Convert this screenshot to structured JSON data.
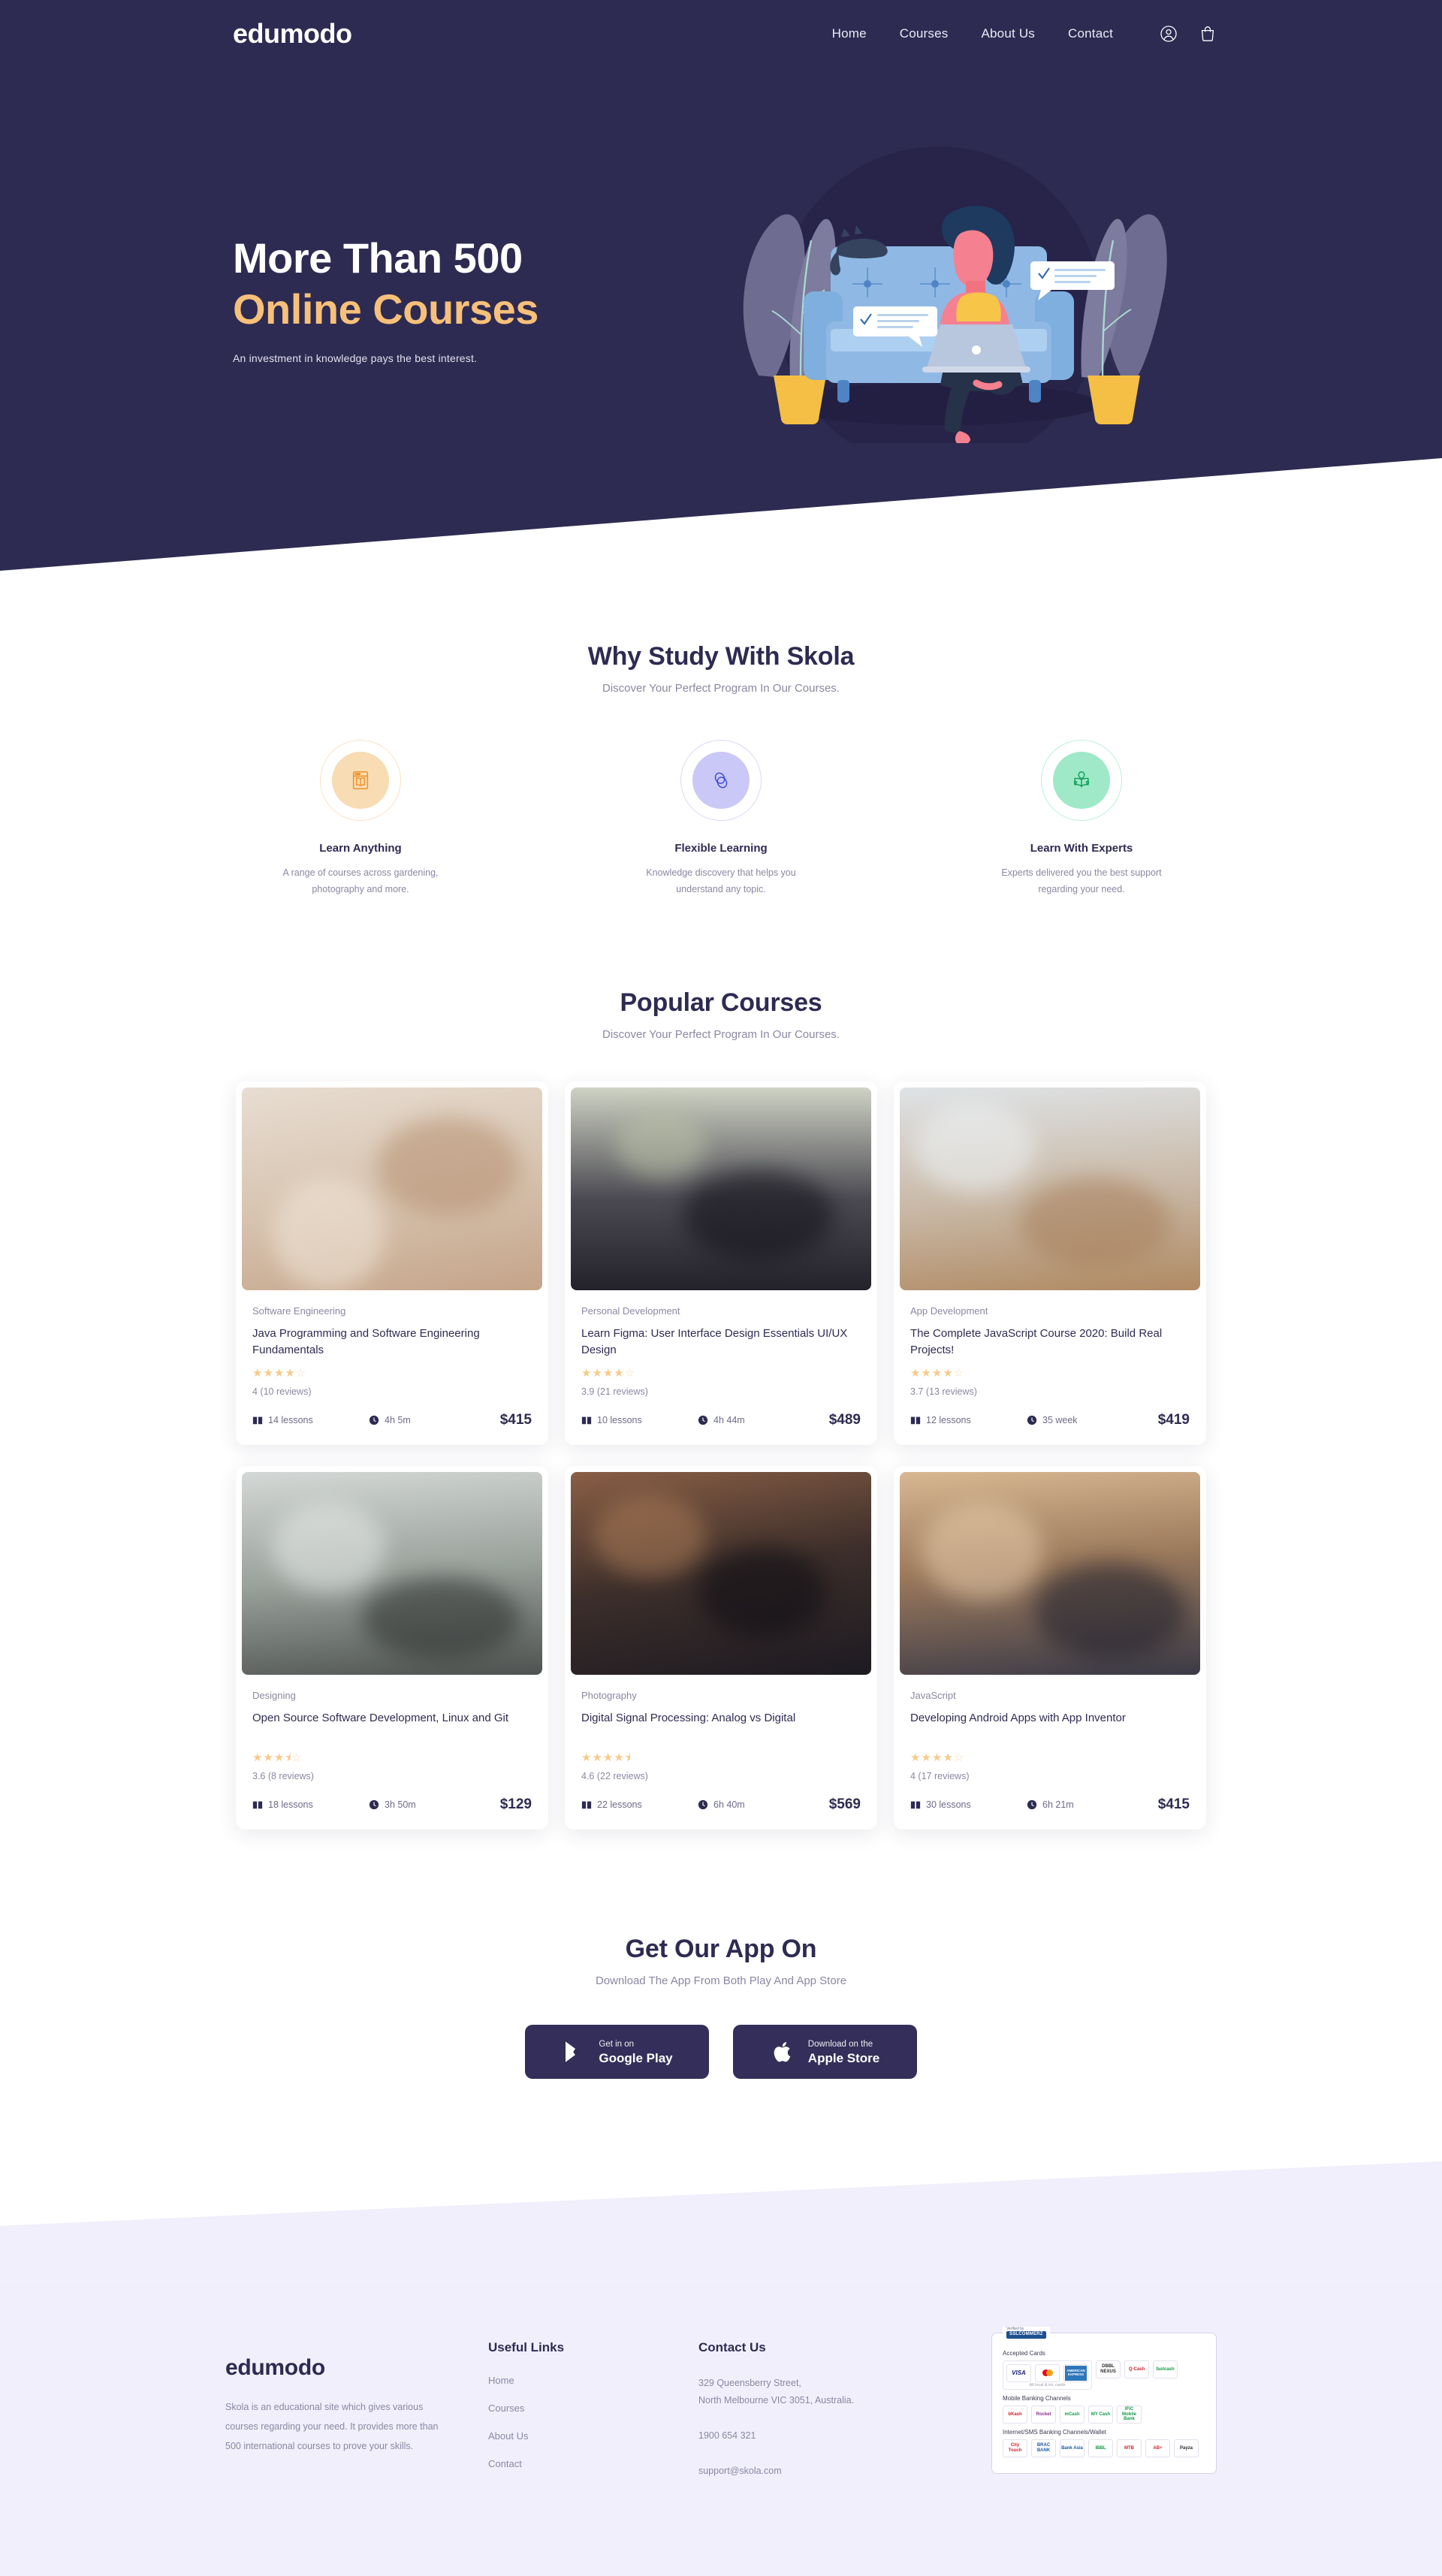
{
  "brand": {
    "name": "edumodo"
  },
  "colors": {
    "navy": "#2e2b52",
    "accent_orange": "#f7c07a",
    "muted": "#8a88a3",
    "footer_bg": "#f0effb",
    "star": "#f9c98a"
  },
  "nav": {
    "links": [
      {
        "label": "Home"
      },
      {
        "label": "Courses"
      },
      {
        "label": "About Us"
      },
      {
        "label": "Contact"
      }
    ],
    "icons": [
      {
        "name": "user-account-icon"
      },
      {
        "name": "shopping-bag-icon"
      }
    ]
  },
  "hero": {
    "title_line1": "More Than 500",
    "title_line2": "Online Courses",
    "subtitle": "An investment in knowledge pays the best interest.",
    "illustration": "woman-on-couch-with-laptop-illustration"
  },
  "why": {
    "title": "Why Study With Skola",
    "subtitle": "Discover Your Perfect Program In Our Courses.",
    "features": [
      {
        "icon": "online-book-window-icon",
        "title": "Learn Anything",
        "desc_line1": "A range of courses across gardening,",
        "desc_line2": "photography and more."
      },
      {
        "icon": "interlocking-rings-icon",
        "title": "Flexible Learning",
        "desc_line1": "Knowledge discovery that helps you",
        "desc_line2": "understand any topic."
      },
      {
        "icon": "person-reading-book-icon",
        "title": "Learn With Experts",
        "desc_line1": "Experts delivered you the best support",
        "desc_line2": "regarding your need."
      }
    ]
  },
  "popular": {
    "title": "Popular Courses",
    "subtitle": "Discover Your Perfect Program In Our Courses.",
    "lesson_icon": "open-book-icon",
    "time_icon": "clock-icon",
    "courses": [
      {
        "category": "Software Engineering",
        "title": "Java Programming and Software Engineering Fundamentals",
        "stars_full": 4,
        "stars_half": 0,
        "rating": "4 (10 reviews)",
        "lessons": "14 lessons",
        "duration": "4h 5m",
        "price": "$415",
        "image": "woman-studying-at-coffee-table-photo"
      },
      {
        "category": "Personal Development",
        "title": "Learn Figma: User Interface Design Essentials UI/UX Design",
        "stars_full": 4,
        "stars_half": 0,
        "rating": "3.9 (21 reviews)",
        "lessons": "10 lessons",
        "duration": "4h 44m",
        "price": "$489",
        "image": "graduation-cap-toss-photo"
      },
      {
        "category": "App Development",
        "title": "The Complete JavaScript Course 2020: Build Real Projects!",
        "stars_full": 4,
        "stars_half": 0,
        "rating": "3.7 (13 reviews)",
        "lessons": "12 lessons",
        "duration": "35 week",
        "price": "$419",
        "image": "team-meeting-in-office-photo"
      },
      {
        "category": "Designing",
        "title": "Open Source Software Development, Linux and Git",
        "stars_full": 3,
        "stars_half": 1,
        "rating": "3.6 (8 reviews)",
        "lessons": "18 lessons",
        "duration": "3h 50m",
        "price": "$129",
        "image": "students-around-laptop-photo"
      },
      {
        "category": "Photography",
        "title": "Digital Signal Processing: Analog vs Digital",
        "stars_full": 4,
        "stars_half": 1,
        "rating": "4.6 (22 reviews)",
        "lessons": "22 lessons",
        "duration": "6h 40m",
        "price": "$569",
        "image": "student-reading-book-in-library-photo"
      },
      {
        "category": "JavaScript",
        "title": "Developing Android Apps with App Inventor",
        "stars_full": 4,
        "stars_half": 0,
        "rating": "4 (17 reviews)",
        "lessons": "30 lessons",
        "duration": "6h 21m",
        "price": "$415",
        "image": "woman-at-desktop-computer-photo"
      }
    ]
  },
  "app": {
    "title": "Get Our App On",
    "subtitle": "Download The App From Both Play And App Store",
    "buttons": [
      {
        "icon": "google-play-icon",
        "small": "Get in on",
        "big": "Google Play"
      },
      {
        "icon": "apple-logo-icon",
        "small": "Download on the",
        "big": "Apple Store"
      }
    ]
  },
  "footer": {
    "brand": "edumodo",
    "about": "Skola is an educational site which gives various courses regarding your need. It provides more than 500 international courses to prove your skills.",
    "links_head": "Useful Links",
    "links": [
      {
        "label": "Home"
      },
      {
        "label": "Courses"
      },
      {
        "label": "About Us"
      },
      {
        "label": "Contact"
      }
    ],
    "contact_head": "Contact Us",
    "address_line1": "329 Queensberry Street,",
    "address_line2": "North Melbourne VIC 3051, Australia.",
    "phone": "1900 654 321",
    "email": "support@skola.com",
    "payments": {
      "verified_text": "Verified by",
      "badge": "SSLCOMMERZ",
      "sections": [
        {
          "label": "Accepted Cards",
          "note": "All local & int. cards",
          "items": [
            "VISA",
            "mastercard",
            "AMERICAN EXPRESS",
            "DBBL NEXUS",
            "Q-Cash",
            "fastcash"
          ]
        },
        {
          "label": "Mobile Banking Channels",
          "items": [
            "bKash",
            "Rocket",
            "mCash",
            "MY Cash",
            "IFIC Mobile Bank"
          ]
        },
        {
          "label": "Internet/SMS Banking Channels/Wallet",
          "items": [
            "City Touch",
            "BRAC BANK",
            "Bank Asia",
            "IBBL",
            "MTB",
            "AB+",
            "Payza"
          ]
        }
      ]
    }
  }
}
